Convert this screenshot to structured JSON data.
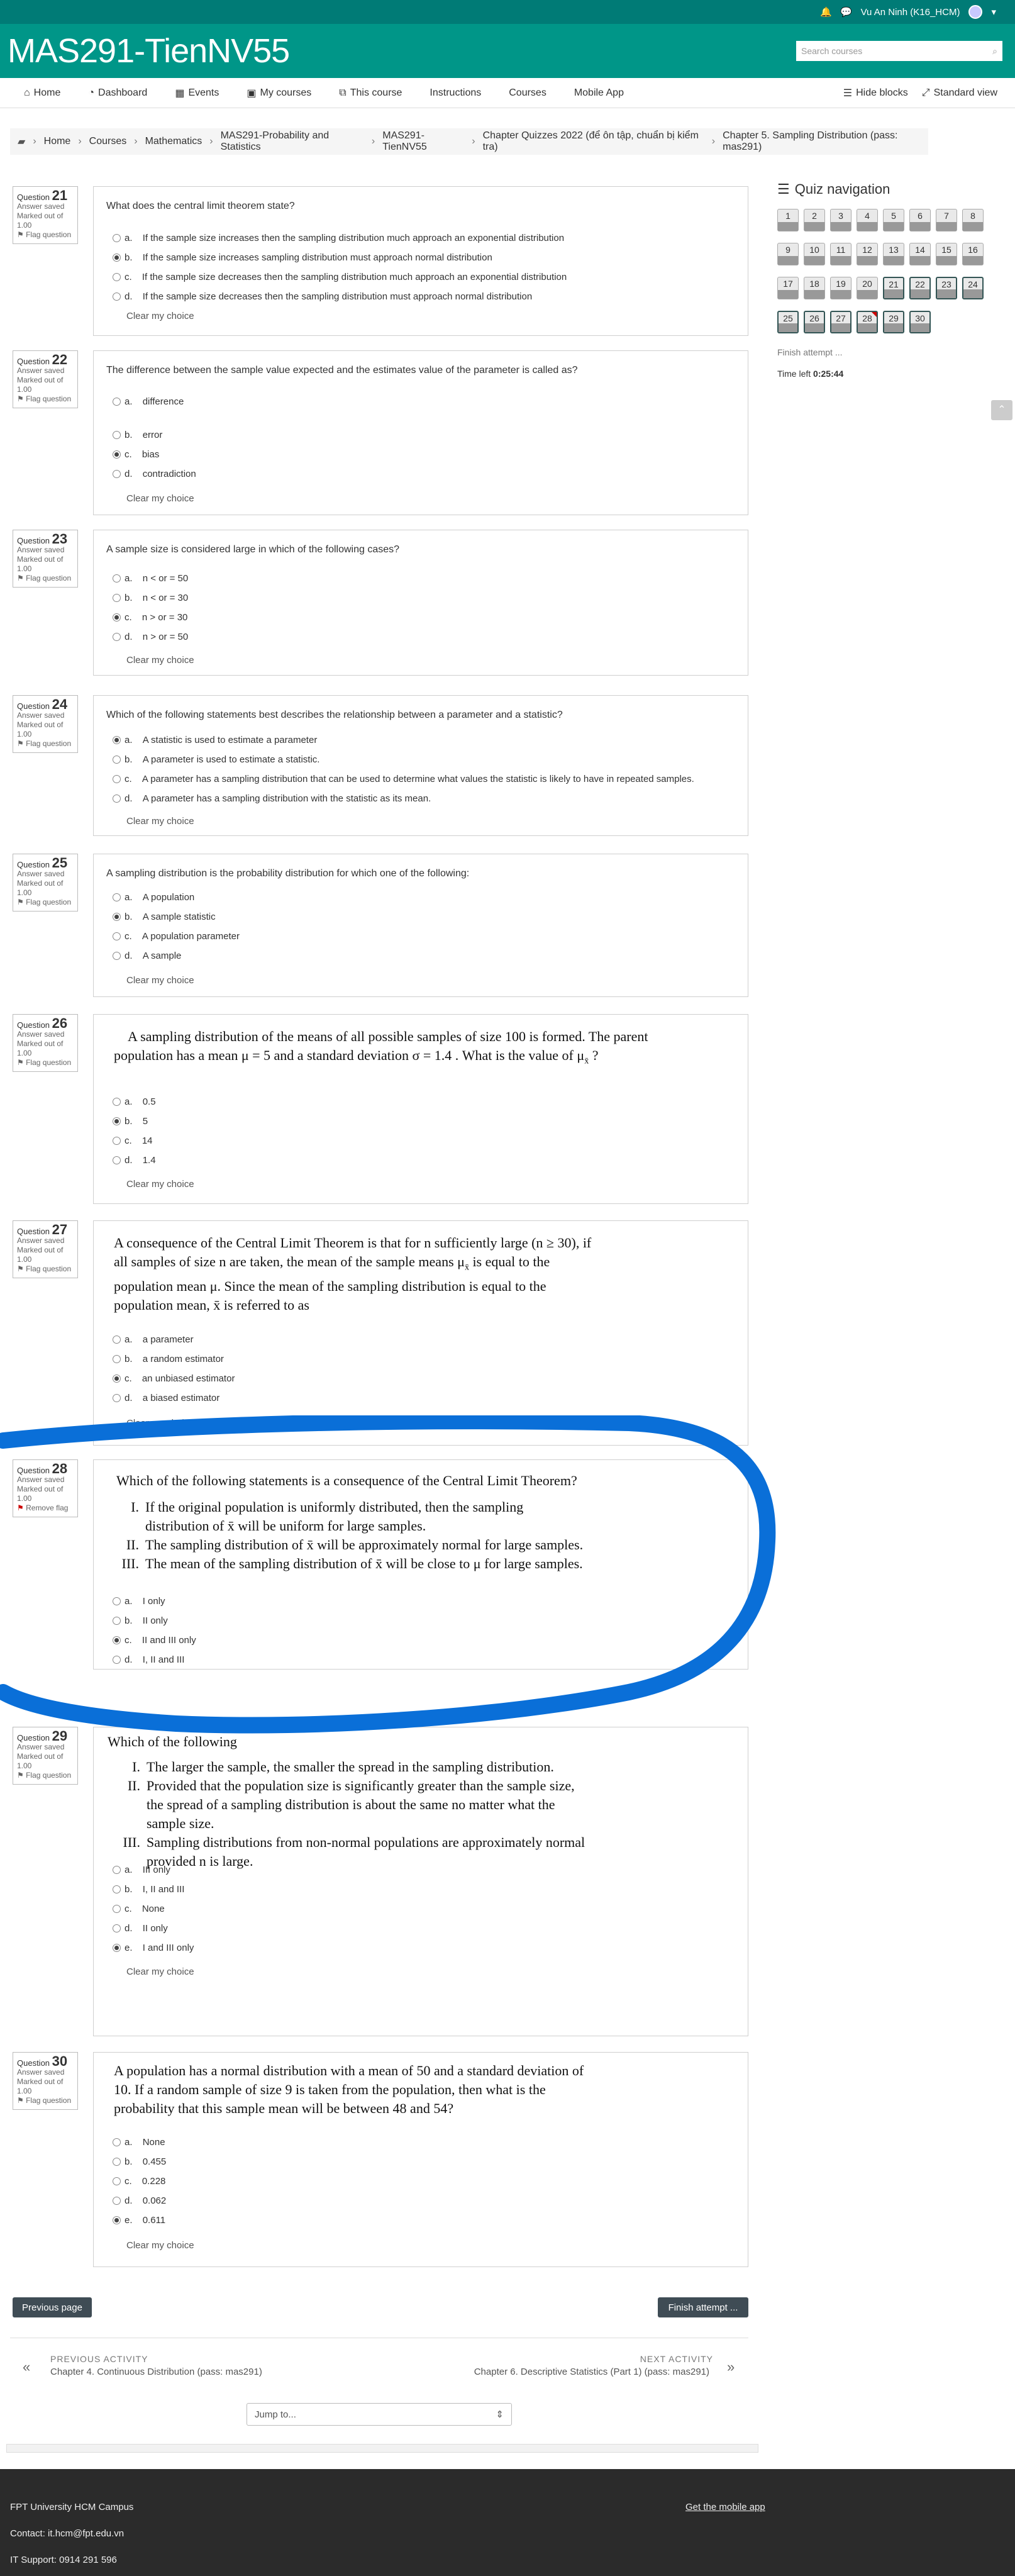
{
  "user": "Vu An Ninh (K16_HCM)",
  "site_title": "MAS291-TienNV55",
  "search_placeholder": "Search courses",
  "nav": [
    "Home",
    "Dashboard",
    "Events",
    "My courses",
    "This course",
    "Instructions",
    "Courses",
    "Mobile App"
  ],
  "nav_right": [
    "Hide blocks",
    "Standard view"
  ],
  "breadcrumb": [
    "Home",
    "Courses",
    "Mathematics",
    "MAS291-Probability and Statistics",
    "MAS291-TienNV55",
    "Chapter Quizzes 2022 (để ôn tập, chuẩn bị kiểm tra)",
    "Chapter 5. Sampling Distribution (pass: mas291)"
  ],
  "q_labels": {
    "question": "Question",
    "saved": "Answer saved",
    "marked": "Marked out of",
    "points": "1.00",
    "flag": "Flag question",
    "remove": "Remove flag",
    "clear": "Clear my choice"
  },
  "questions": [
    {
      "num": "21",
      "text": "What does the central limit theorem state?",
      "options": [
        [
          "a.",
          "If the sample size increases then the sampling distribution much approach an exponential distribution"
        ],
        [
          "b.",
          "If the sample size increases sampling distribution must approach normal distribution"
        ],
        [
          "c.",
          "If the sample size decreases then the sampling distribution much approach an exponential distribution"
        ],
        [
          "d.",
          "If the sample size decreases then the sampling distribution must approach normal distribution"
        ]
      ],
      "selected": 1
    },
    {
      "num": "22",
      "text": "The difference between the sample value expected and the estimates value of the parameter is called as?",
      "options": [
        [
          "a.",
          "difference"
        ],
        [
          "b.",
          "error"
        ],
        [
          "c.",
          "bias"
        ],
        [
          "d.",
          "contradiction"
        ]
      ],
      "selected": 2
    },
    {
      "num": "23",
      "text": "A sample size is considered large in which of the following cases?",
      "options": [
        [
          "a.",
          "n < or = 50"
        ],
        [
          "b.",
          "n < or = 30"
        ],
        [
          "c.",
          "n > or = 30"
        ],
        [
          "d.",
          "n > or = 50"
        ]
      ],
      "selected": 2
    },
    {
      "num": "24",
      "text": "Which of the following statements best describes the relationship between a parameter and a statistic?",
      "options": [
        [
          "a.",
          "A statistic is used to estimate a parameter"
        ],
        [
          "b.",
          "A parameter is used to estimate a statistic."
        ],
        [
          "c.",
          "A parameter has a sampling distribution that can be used to determine what values the statistic is likely to have in repeated samples."
        ],
        [
          "d.",
          "A parameter has a sampling distribution with the statistic as its mean."
        ]
      ],
      "selected": 0
    },
    {
      "num": "25",
      "text": "A sampling distribution is the probability distribution for which one of the following:",
      "options": [
        [
          "a.",
          "A population"
        ],
        [
          "b.",
          "A sample statistic"
        ],
        [
          "c.",
          "A population parameter"
        ],
        [
          "d.",
          "A sample"
        ]
      ],
      "selected": 1
    },
    {
      "num": "26",
      "text": "",
      "options": [
        [
          "a.",
          "0.5"
        ],
        [
          "b.",
          "5"
        ],
        [
          "c.",
          "14"
        ],
        [
          "d.",
          "1.4"
        ]
      ],
      "selected": 1
    },
    {
      "num": "27",
      "text": "",
      "options": [
        [
          "a.",
          "a parameter"
        ],
        [
          "b.",
          "a random estimator"
        ],
        [
          "c.",
          "an unbiased estimator"
        ],
        [
          "d.",
          "a biased estimator"
        ]
      ],
      "selected": 2
    },
    {
      "num": "28",
      "text": "",
      "options": [
        [
          "a.",
          "I only"
        ],
        [
          "b.",
          "II only"
        ],
        [
          "c.",
          "II and III only"
        ],
        [
          "d.",
          "I, II and III"
        ]
      ],
      "selected": 2
    },
    {
      "num": "29",
      "text": "",
      "options": [
        [
          "a.",
          "III only"
        ],
        [
          "b.",
          "I, II and III"
        ],
        [
          "c.",
          "None"
        ],
        [
          "d.",
          "II only"
        ],
        [
          "e.",
          "I and III only"
        ]
      ],
      "selected": 4
    },
    {
      "num": "30",
      "text": "",
      "options": [
        [
          "a.",
          "None"
        ],
        [
          "b.",
          "0.455"
        ],
        [
          "c.",
          "0.228"
        ],
        [
          "d.",
          "0.062"
        ],
        [
          "e.",
          "0.611"
        ]
      ],
      "selected": 4
    }
  ],
  "q26_text_1": "A sampling distribution of the means of all possible samples of size 100 is formed.  The parent",
  "q26_text_2": "population has a mean  μ = 5 and a standard deviation  σ = 1.4 . What is the value of  μ",
  "q26_text_2_sub": "x̄",
  "q26_text_2_end": " ?",
  "q27_lines": [
    "A consequence of the Central Limit Theorem is that for n sufficiently large (n ≥ 30), if",
    "all samples of size n are taken, the mean of the sample means μ",
    "is equal to the",
    "population mean μ. Since the mean of the sampling distribution is equal to the",
    "population mean, x̄ is referred to as"
  ],
  "q27_sub": "x̄",
  "q28_title": "Which of the following statements is a consequence of the Central Limit Theorem?",
  "q28_items": [
    [
      "I.",
      "If the original population is uniformly distributed, then the sampling"
    ],
    [
      "",
      "distribution of x̄ will be uniform for large samples."
    ],
    [
      "II.",
      "The sampling distribution of x̄ will be approximately normal for large samples."
    ],
    [
      "III.",
      "The mean of the sampling distribution of x̄ will be close to μ for large samples."
    ]
  ],
  "q29_title": "Which of the following",
  "q29_items": [
    [
      "I.",
      "The larger the sample, the smaller the spread in the sampling distribution."
    ],
    [
      "II.",
      "Provided that the population size is significantly greater than the sample size,"
    ],
    [
      "",
      "the spread of a sampling distribution is about the same no matter what the"
    ],
    [
      "",
      "sample size."
    ],
    [
      "III.",
      "Sampling distributions from non-normal populations are approximately normal"
    ],
    [
      "",
      "provided n is large."
    ]
  ],
  "q30_lines": [
    "A population has a normal distribution with a mean of 50 and a standard deviation of",
    "10. If a random sample of size 9 is taken from the population, then what is the",
    "probability that this sample mean will be between 48 and 54?"
  ],
  "quiz_nav": {
    "title": "Quiz navigation",
    "cells": [
      "1",
      "2",
      "3",
      "4",
      "5",
      "6",
      "7",
      "8",
      "9",
      "10",
      "11",
      "12",
      "13",
      "14",
      "15",
      "16",
      "17",
      "18",
      "19",
      "20",
      "21",
      "22",
      "23",
      "24",
      "25",
      "26",
      "27",
      "28",
      "29",
      "30"
    ],
    "finish": "Finish attempt ...",
    "time_label": "Time left",
    "time": "0:25:44"
  },
  "buttons": {
    "prev": "Previous page",
    "finish": "Finish attempt ..."
  },
  "activity": {
    "prev_label": "PREVIOUS ACTIVITY",
    "prev": "Chapter 4. Continuous Distribution (pass: mas291)",
    "next_label": "NEXT ACTIVITY",
    "next": "Chapter 6. Descriptive Statistics (Part 1) (pass: mas291)",
    "jump": "Jump to..."
  },
  "footer": {
    "campus": "FPT University HCM Campus",
    "contact": "Contact: it.hcm@fpt.edu.vn",
    "support": "IT Support: 0914 291 596",
    "app": "Get the mobile app"
  },
  "colors": {
    "teal": "#009688",
    "dark_teal": "#007b76",
    "annot": "#0a6fd8"
  }
}
